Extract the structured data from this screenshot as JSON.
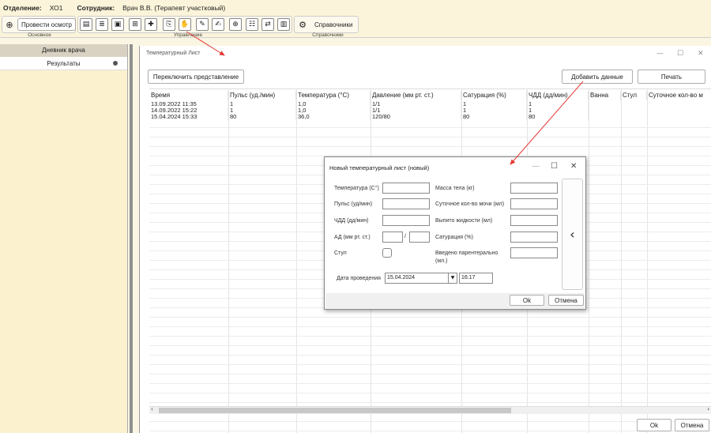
{
  "header": {
    "dept_label": "Отделение:",
    "dept_value": "ХО1",
    "employee_label": "Сотрудник:",
    "employee_value": "Врач В.В. (Терапевт участковый)"
  },
  "toolbar": {
    "exam_button": "Провести осмотр",
    "refs_button": "Справочники",
    "groups": [
      "Основное",
      "Управление",
      "Справочники"
    ]
  },
  "sidebar": {
    "title": "Дневник врача",
    "items": [
      {
        "label": "Результаты"
      }
    ]
  },
  "window": {
    "title": "Температурный Лист",
    "switch_view_button": "Переключить представление",
    "add_data_button": "Добавить данные",
    "print_button": "Печать",
    "ok_button": "Ok",
    "cancel_button": "Отмена",
    "columns": [
      "Время",
      "Пульс (уд./мин)",
      "Температура (°C)",
      "Давление (мм рт. ст.)",
      "Сатурация (%)",
      "ЧДД (дд/мин)",
      "Ванна",
      "Стул",
      "Суточное кол-во м"
    ],
    "rows": [
      [
        "13.09.2022 11:35",
        "1",
        "1,0",
        "1/1",
        "1",
        "1",
        "",
        "",
        ""
      ],
      [
        "14.09.2022 15:22",
        "1",
        "1,0",
        "1/1",
        "1",
        "1",
        "",
        "",
        ""
      ],
      [
        "15.04.2024 15:33",
        "80",
        "36,0",
        "120/80",
        "80",
        "80",
        "",
        "",
        ""
      ]
    ]
  },
  "dialog": {
    "title": "Новый температурный лист (новый)",
    "temp_label": "Температура (C°)",
    "pulse_label": "Пульс (уд/мин)",
    "rr_label": "ЧДД (дд/мин)",
    "bp_label": "АД (мм рт. ст.)",
    "stool_label": "Стул",
    "weight_label": "Масса тела (кг)",
    "urine_label": "Суточное кол-во мочи (мл)",
    "fluid_label": "Выпито жидкости (мл)",
    "sat_label": "Сатурация (%)",
    "parenteral_label_1": "Введено парентерально",
    "parenteral_label_2": "(мл.)",
    "bp_separator": "/",
    "date_label": "Дата проведения",
    "date_value": "15.04.2024",
    "time_value": "16:17",
    "ok_button": "Ok",
    "cancel_button": "Отмена"
  },
  "colors": {
    "annotation_arrow": "#e53935",
    "top_bg": "#fbf4da",
    "sidebar_bg": "#fbf1cf"
  }
}
